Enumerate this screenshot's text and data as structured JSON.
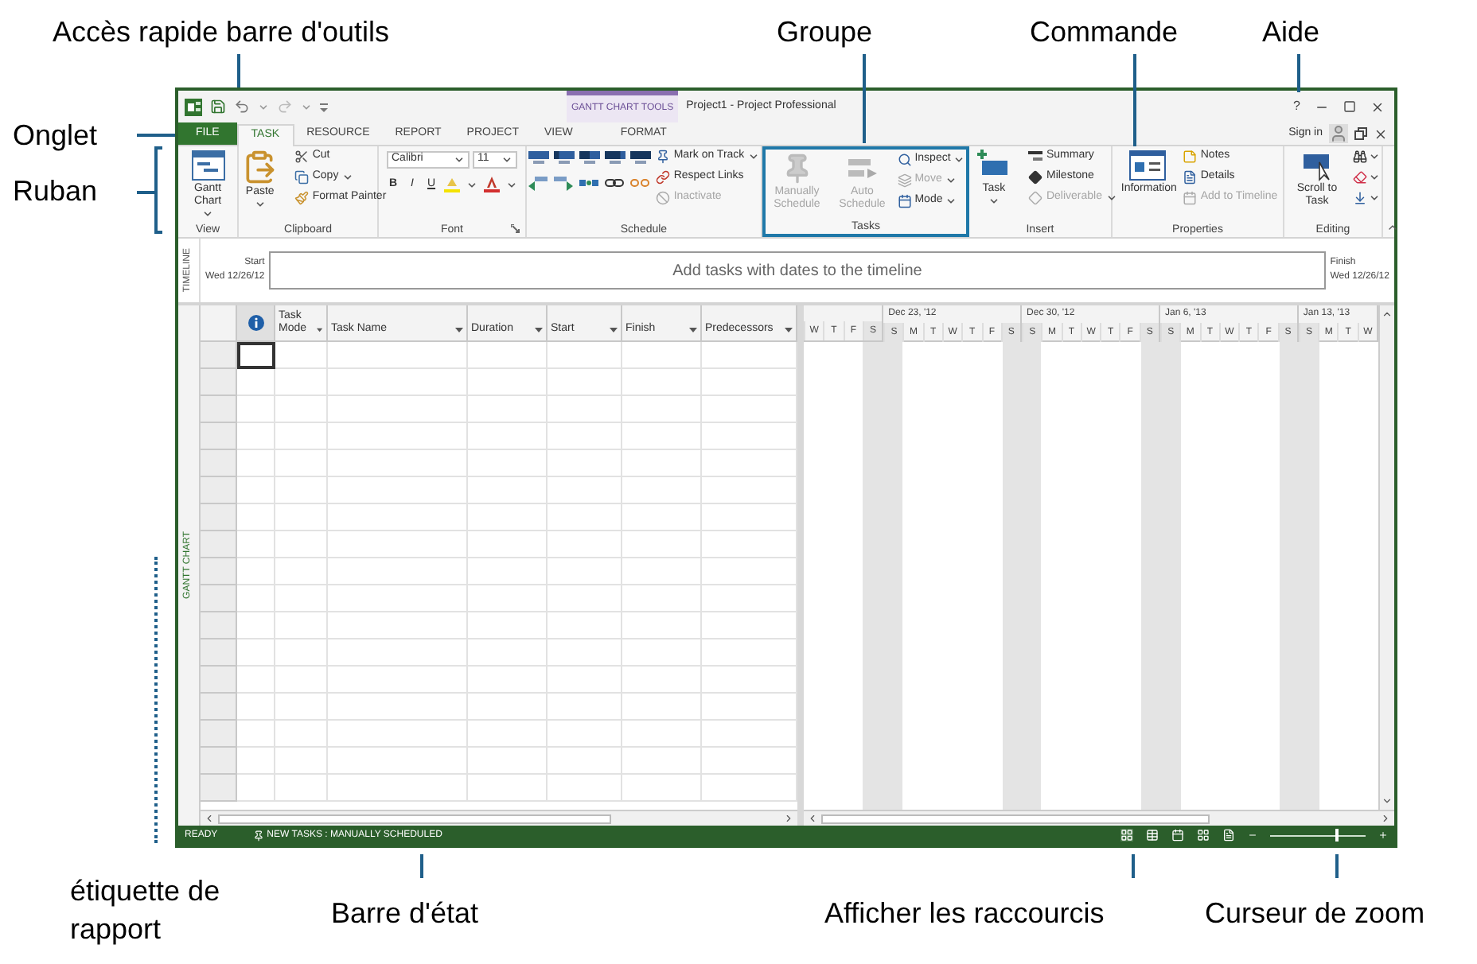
{
  "callouts": [
    {
      "text": "Accès rapide barre d'outils"
    },
    {
      "text": "Groupe"
    },
    {
      "text": "Commande"
    },
    {
      "text": "Aide"
    },
    {
      "text": "Onglet"
    },
    {
      "text": "Ruban"
    },
    {
      "text": "étiquette de rapport"
    },
    {
      "text": "Barre d'état"
    },
    {
      "text": "Afficher les raccourcis"
    },
    {
      "text": "Curseur de zoom"
    }
  ],
  "window": {
    "context_tab": "GANTT CHART TOOLS",
    "title": "Project1 - Project Professional",
    "help": "?",
    "sign_in": "Sign in"
  },
  "tabs": [
    {
      "label": "FILE",
      "kind": "file",
      "selected": false
    },
    {
      "label": "TASK",
      "kind": "tab",
      "selected": true
    },
    {
      "label": "RESOURCE",
      "kind": "tab",
      "selected": false
    },
    {
      "label": "REPORT",
      "kind": "tab",
      "selected": false
    },
    {
      "label": "PROJECT",
      "kind": "tab",
      "selected": false
    },
    {
      "label": "VIEW",
      "kind": "tab",
      "selected": false
    },
    {
      "label": "FORMAT",
      "kind": "context",
      "selected": false
    }
  ],
  "ribbon": {
    "groups": [
      {
        "title": "View",
        "highlighted": false,
        "launcher": false,
        "columns": [
          [
            {
              "kind": "large",
              "label": "Gantt Chart",
              "dropdown": true,
              "disabled": false
            }
          ]
        ]
      },
      {
        "title": "Clipboard",
        "highlighted": false,
        "launcher": false,
        "columns": [
          [
            {
              "kind": "large",
              "label": "Paste",
              "dropdown": true,
              "disabled": false
            }
          ],
          [
            {
              "kind": "small",
              "label": "Cut",
              "dropdown": false,
              "disabled": false
            },
            {
              "kind": "small",
              "label": "Copy",
              "dropdown": true,
              "disabled": false
            },
            {
              "kind": "small",
              "label": "Format Painter",
              "dropdown": false,
              "disabled": false
            }
          ]
        ]
      },
      {
        "title": "Font",
        "highlighted": false,
        "launcher": true,
        "columns": [
          [
            {
              "kind": "font",
              "name": "Calibri",
              "size": "11",
              "styles": [
                "B",
                "I",
                "U"
              ]
            }
          ]
        ]
      },
      {
        "title": "Schedule",
        "highlighted": false,
        "launcher": false,
        "columns": [
          [
            {
              "kind": "schedule_buttons"
            }
          ],
          [
            {
              "kind": "small",
              "label": "Mark on Track",
              "dropdown": true,
              "disabled": false
            },
            {
              "kind": "small",
              "label": "Respect Links",
              "dropdown": false,
              "disabled": false
            },
            {
              "kind": "small",
              "label": "Inactivate",
              "dropdown": false,
              "disabled": true
            }
          ]
        ]
      },
      {
        "title": "Tasks",
        "highlighted": true,
        "launcher": false,
        "columns": [
          [
            {
              "kind": "large",
              "label": "Manually Schedule",
              "dropdown": false,
              "disabled": true
            }
          ],
          [
            {
              "kind": "large",
              "label": "Auto Schedule",
              "dropdown": false,
              "disabled": true
            }
          ],
          [
            {
              "kind": "small",
              "label": "Inspect",
              "dropdown": true,
              "disabled": false
            },
            {
              "kind": "small",
              "label": "Move",
              "dropdown": true,
              "disabled": true
            },
            {
              "kind": "small",
              "label": "Mode",
              "dropdown": true,
              "disabled": false
            }
          ]
        ]
      },
      {
        "title": "Insert",
        "highlighted": false,
        "launcher": false,
        "columns": [
          [
            {
              "kind": "large",
              "label": "Task",
              "dropdown": true,
              "disabled": false
            }
          ],
          [
            {
              "kind": "small",
              "label": "Summary",
              "dropdown": false,
              "disabled": false
            },
            {
              "kind": "small",
              "label": "Milestone",
              "dropdown": false,
              "disabled": false
            },
            {
              "kind": "small",
              "label": "Deliverable",
              "dropdown": true,
              "disabled": true
            }
          ]
        ]
      },
      {
        "title": "Properties",
        "highlighted": false,
        "launcher": false,
        "columns": [
          [
            {
              "kind": "large",
              "label": "Information",
              "dropdown": false,
              "disabled": false
            }
          ],
          [
            {
              "kind": "small",
              "label": "Notes",
              "dropdown": false,
              "disabled": false
            },
            {
              "kind": "small",
              "label": "Details",
              "dropdown": false,
              "disabled": false
            },
            {
              "kind": "small",
              "label": "Add to Timeline",
              "dropdown": false,
              "disabled": true
            }
          ]
        ]
      },
      {
        "title": "Editing",
        "highlighted": false,
        "launcher": false,
        "columns": [
          [
            {
              "kind": "large",
              "label": "Scroll to Task",
              "dropdown": false,
              "disabled": false
            }
          ],
          [
            {
              "kind": "icon",
              "dropdown": true,
              "disabled": false
            },
            {
              "kind": "icon",
              "dropdown": true,
              "disabled": false
            },
            {
              "kind": "icon",
              "dropdown": true,
              "disabled": false
            }
          ]
        ]
      }
    ]
  },
  "timeline": {
    "side_label": "TIMELINE",
    "start_label": "Start",
    "start_date": "Wed 12/26/12",
    "placeholder": "Add tasks with dates to the timeline",
    "finish_label": "Finish",
    "finish_date": "Wed 12/26/12"
  },
  "view_label": "GANTT CHART",
  "table": {
    "columns": [
      {
        "label": "Task Mode",
        "dropdown": true
      },
      {
        "label": "Task Name",
        "dropdown": true
      },
      {
        "label": "Duration",
        "dropdown": true
      },
      {
        "label": "Start",
        "dropdown": true
      },
      {
        "label": "Finish",
        "dropdown": true
      },
      {
        "label": "Predecessors",
        "dropdown": true
      }
    ]
  },
  "timescale": {
    "weeks": [
      {
        "days": [
          {
            "label": "W",
            "weekend": false
          },
          {
            "label": "T",
            "weekend": false
          },
          {
            "label": "F",
            "weekend": false
          },
          {
            "label": "S",
            "weekend": true
          }
        ]
      },
      {
        "label": "Dec 23, '12",
        "days": [
          {
            "label": "S",
            "weekend": true
          },
          {
            "label": "M",
            "weekend": false
          },
          {
            "label": "T",
            "weekend": false
          },
          {
            "label": "W",
            "weekend": false
          },
          {
            "label": "T",
            "weekend": false
          },
          {
            "label": "F",
            "weekend": false
          },
          {
            "label": "S",
            "weekend": true
          }
        ]
      },
      {
        "label": "Dec 30, '12",
        "days": [
          {
            "label": "S",
            "weekend": true
          },
          {
            "label": "M",
            "weekend": false
          },
          {
            "label": "T",
            "weekend": false
          },
          {
            "label": "W",
            "weekend": false
          },
          {
            "label": "T",
            "weekend": false
          },
          {
            "label": "F",
            "weekend": false
          },
          {
            "label": "S",
            "weekend": true
          }
        ]
      },
      {
        "label": "Jan 6, '13",
        "days": [
          {
            "label": "S",
            "weekend": true
          },
          {
            "label": "M",
            "weekend": false
          },
          {
            "label": "T",
            "weekend": false
          },
          {
            "label": "W",
            "weekend": false
          },
          {
            "label": "T",
            "weekend": false
          },
          {
            "label": "F",
            "weekend": false
          },
          {
            "label": "S",
            "weekend": true
          }
        ]
      },
      {
        "label": "Jan 13, '13",
        "days": [
          {
            "label": "S",
            "weekend": true
          },
          {
            "label": "M",
            "weekend": false
          },
          {
            "label": "T",
            "weekend": false
          },
          {
            "label": "W",
            "weekend": false
          }
        ]
      }
    ]
  },
  "status_bar": {
    "ready": "READY",
    "new_tasks": "NEW TASKS : MANUALLY SCHEDULED",
    "zoom": {
      "level": 0.68
    }
  }
}
